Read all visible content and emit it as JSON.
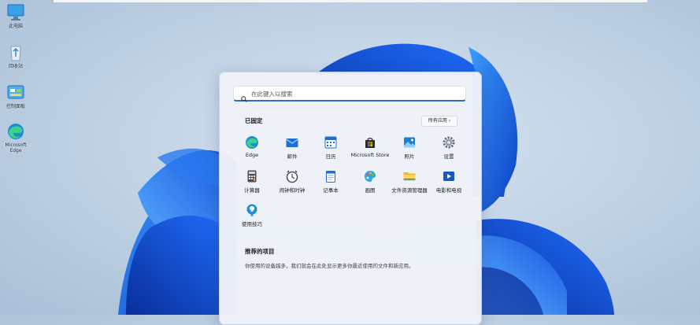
{
  "desktop": {
    "icons": [
      {
        "label": "此电脑",
        "icon": "computer-icon"
      },
      {
        "label": "回收站",
        "icon": "recycle-bin-icon"
      },
      {
        "label": "控制面板",
        "icon": "control-panel-icon"
      },
      {
        "label": "Microsoft Edge",
        "icon": "edge-icon"
      }
    ]
  },
  "start_menu": {
    "search": {
      "placeholder": "在此键入以搜索"
    },
    "pinned": {
      "title": "已固定",
      "all_apps_label": "所有应用  ›",
      "apps": [
        {
          "label": "Edge",
          "icon": "edge-icon"
        },
        {
          "label": "邮件",
          "icon": "mail-icon"
        },
        {
          "label": "日历",
          "icon": "calendar-icon"
        },
        {
          "label": "Microsoft Store",
          "icon": "store-icon"
        },
        {
          "label": "照片",
          "icon": "photos-icon"
        },
        {
          "label": "设置",
          "icon": "settings-gear-icon"
        },
        {
          "label": "计算器",
          "icon": "calculator-icon"
        },
        {
          "label": "闹钟和时钟",
          "icon": "alarm-clock-icon"
        },
        {
          "label": "记事本",
          "icon": "notepad-icon"
        },
        {
          "label": "画图",
          "icon": "paint-icon"
        },
        {
          "label": "文件资源管理器",
          "icon": "file-explorer-icon"
        },
        {
          "label": "电影和电视",
          "icon": "movies-tv-icon"
        },
        {
          "label": "使用技巧",
          "icon": "tips-icon"
        }
      ]
    },
    "recommended": {
      "title": "推荐的项目",
      "description": "你使用的设备越多，我们就会在此处显示更多你最近使用的文件和新应用。"
    }
  },
  "colors": {
    "accent": "#2b6cd4",
    "bloom_dark": "#0b3fc4",
    "bloom_light": "#2f8cff"
  }
}
